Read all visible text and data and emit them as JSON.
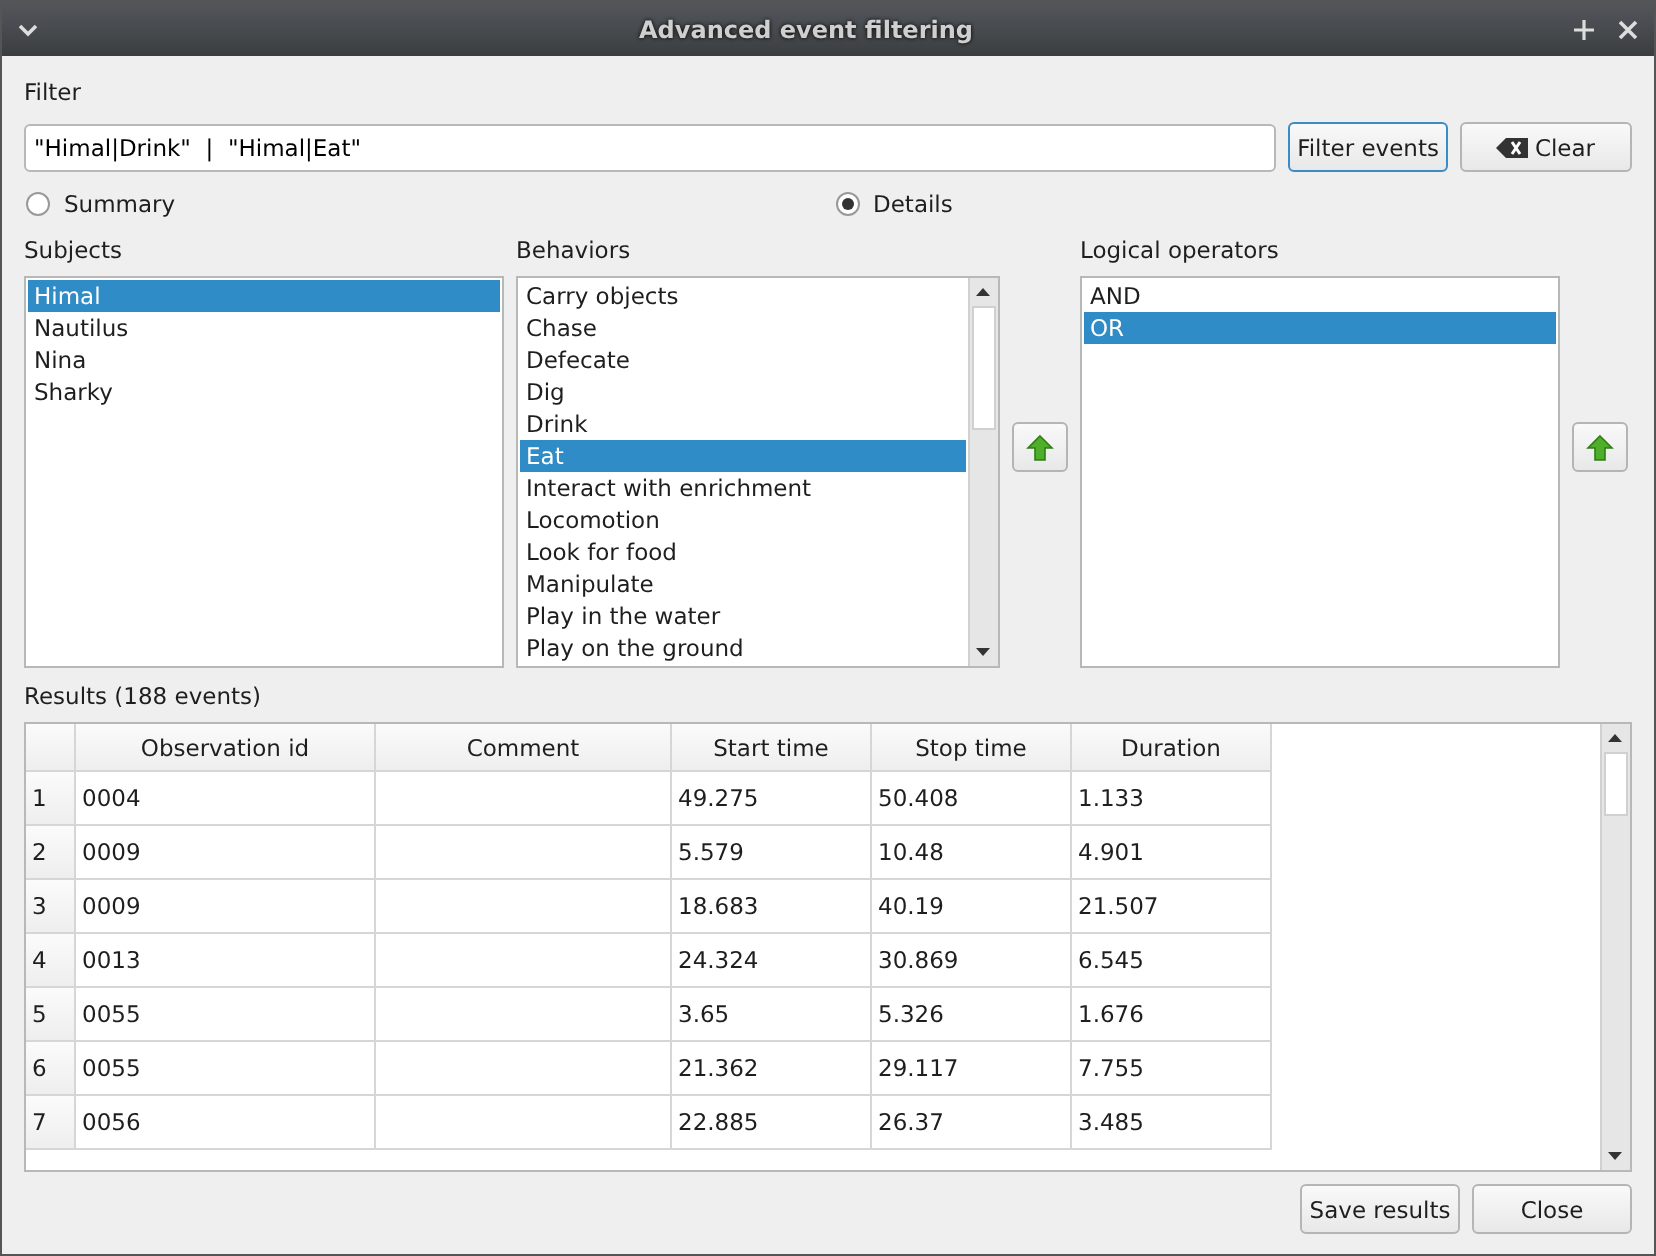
{
  "window": {
    "title": "Advanced event filtering"
  },
  "filter": {
    "label": "Filter",
    "value": "\"Himal|Drink\"  |  \"Himal|Eat\"",
    "filter_button": "Filter events",
    "clear_button": "Clear"
  },
  "modes": [
    {
      "label": "Summary",
      "selected": false
    },
    {
      "label": "Details",
      "selected": true
    }
  ],
  "subjects": {
    "label": "Subjects",
    "items": [
      {
        "label": "Himal",
        "selected": true
      },
      {
        "label": "Nautilus",
        "selected": false
      },
      {
        "label": "Nina",
        "selected": false
      },
      {
        "label": "Sharky",
        "selected": false
      }
    ]
  },
  "behaviors": {
    "label": "Behaviors",
    "items": [
      {
        "label": "Carry objects",
        "selected": false
      },
      {
        "label": "Chase",
        "selected": false
      },
      {
        "label": "Defecate",
        "selected": false
      },
      {
        "label": "Dig",
        "selected": false
      },
      {
        "label": "Drink",
        "selected": false
      },
      {
        "label": "Eat",
        "selected": true
      },
      {
        "label": "Interact with enrichment",
        "selected": false
      },
      {
        "label": "Locomotion",
        "selected": false
      },
      {
        "label": "Look for food",
        "selected": false
      },
      {
        "label": "Manipulate",
        "selected": false
      },
      {
        "label": "Play in the water",
        "selected": false
      },
      {
        "label": "Play on the ground",
        "selected": false
      }
    ]
  },
  "operators": {
    "label": "Logical operators",
    "items": [
      {
        "label": "AND",
        "selected": false
      },
      {
        "label": "OR",
        "selected": true
      }
    ]
  },
  "results": {
    "label": "Results (188 events)",
    "columns": [
      "Observation id",
      "Comment",
      "Start time",
      "Stop time",
      "Duration"
    ],
    "rows": [
      {
        "number": "1",
        "cells": [
          "0004",
          "",
          "49.275",
          "50.408",
          "1.133"
        ]
      },
      {
        "number": "2",
        "cells": [
          "0009",
          "",
          "5.579",
          "10.48",
          "4.901"
        ]
      },
      {
        "number": "3",
        "cells": [
          "0009",
          "",
          "18.683",
          "40.19",
          "21.507"
        ]
      },
      {
        "number": "4",
        "cells": [
          "0013",
          "",
          "24.324",
          "30.869",
          "6.545"
        ]
      },
      {
        "number": "5",
        "cells": [
          "0055",
          "",
          "3.65",
          "5.326",
          "1.676"
        ]
      },
      {
        "number": "6",
        "cells": [
          "0055",
          "",
          "21.362",
          "29.117",
          "7.755"
        ]
      },
      {
        "number": "7",
        "cells": [
          "0056",
          "",
          "22.885",
          "26.37",
          "3.485"
        ]
      }
    ]
  },
  "buttons": [
    "Save results",
    "Close"
  ]
}
